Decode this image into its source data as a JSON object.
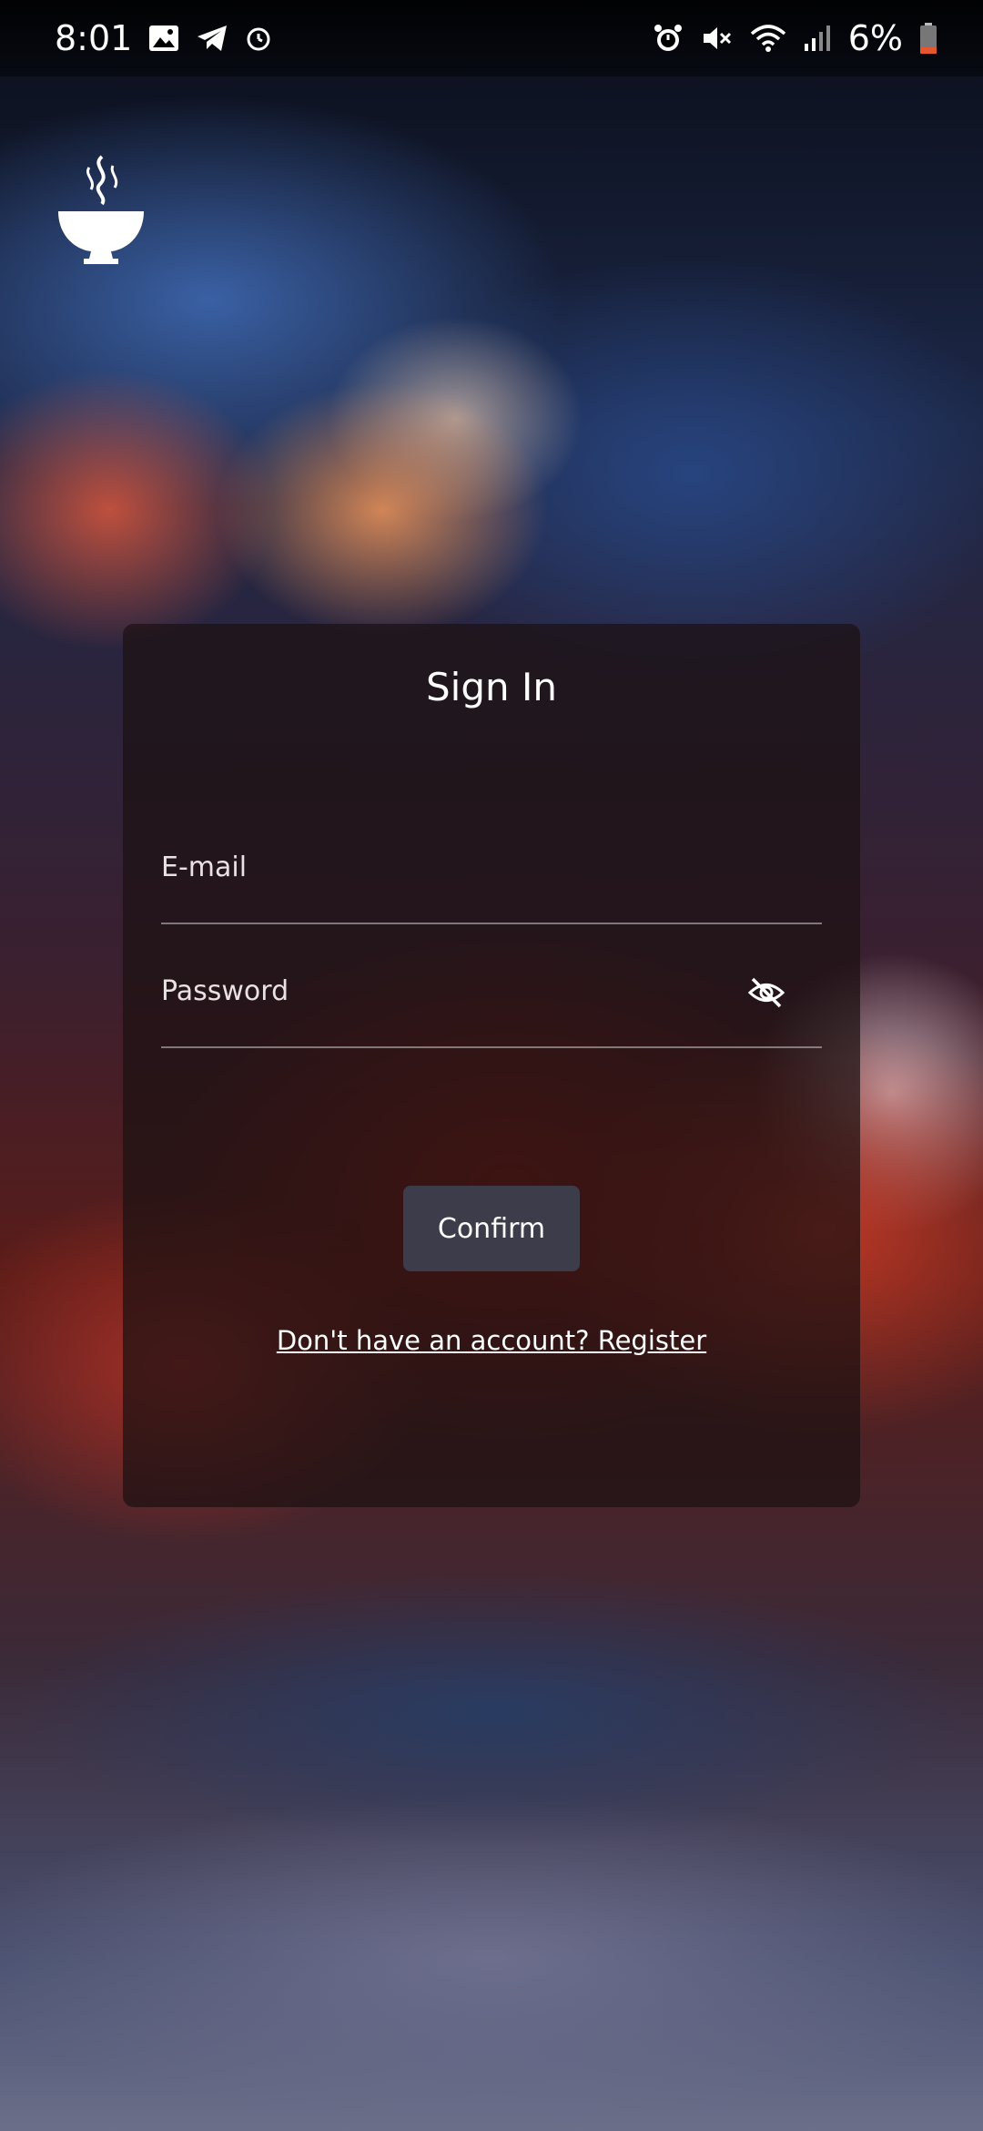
{
  "status_bar": {
    "time": "8:01",
    "battery_percent": "6%",
    "left_icons": [
      "gallery-icon",
      "telegram-icon",
      "alarm-clock-icon"
    ],
    "right_icons": [
      "alarm-icon",
      "mute-icon",
      "wifi-icon",
      "signal-icon",
      "battery-icon"
    ]
  },
  "logo": {
    "icon": "steaming-bowl-icon"
  },
  "signin": {
    "title": "Sign In",
    "email_placeholder": "E-mail",
    "password_placeholder": "Password",
    "password_toggle_icon": "eye-off-icon",
    "confirm_label": "Confirm",
    "register_link": "Don't have an account? Register"
  },
  "colors": {
    "card_background": "#1c1012",
    "button_background": "#3d3c4a",
    "text": "#ffffff",
    "battery_low": "#e4572e"
  }
}
